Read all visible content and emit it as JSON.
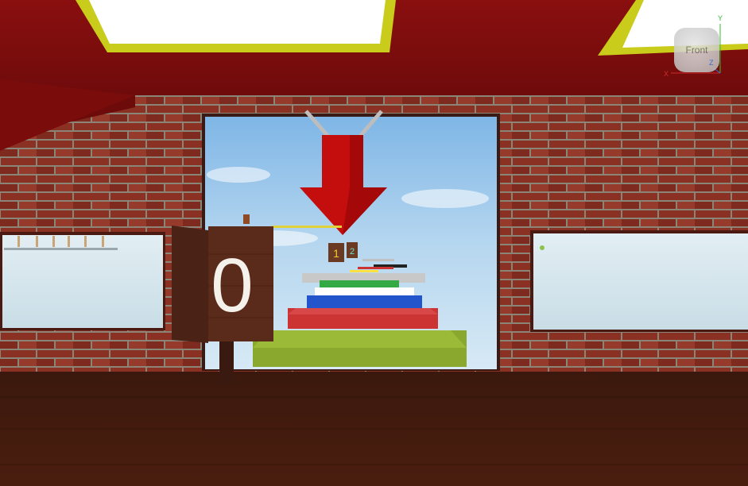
{
  "scene": {
    "stage_sign_number": "0",
    "distant_stage_numbers": [
      "1",
      "2"
    ],
    "obby_step_colors": [
      "#8aa82e",
      "#cc3333",
      "#2255cc",
      "#ffffff",
      "#33aa44",
      "#c8c8c8"
    ]
  },
  "view_cube": {
    "face_label": "Front",
    "axis_x": "X",
    "axis_y": "Y",
    "axis_z": "Z"
  }
}
